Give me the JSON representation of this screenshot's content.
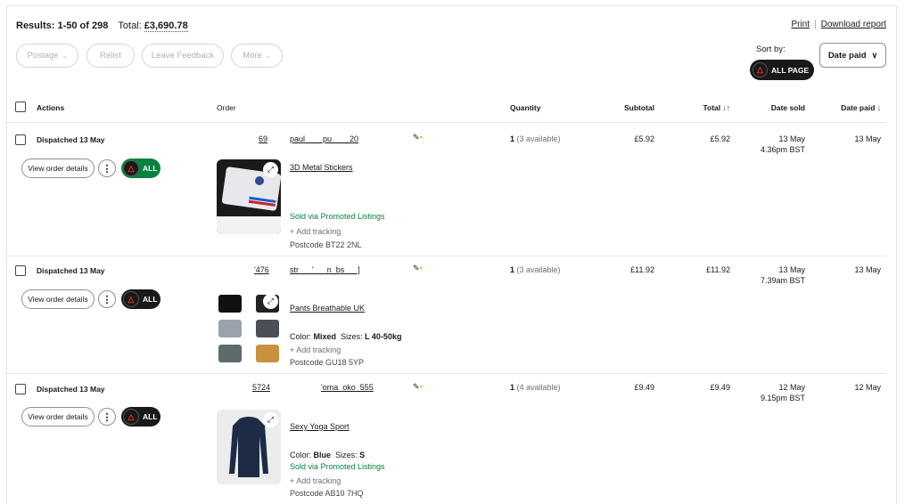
{
  "header": {
    "results": "Results: 1-50 of 298",
    "total_label": "Total:",
    "total_value": "£3,690.78",
    "print": "Print",
    "download": "Download report"
  },
  "filters": [
    "Postage",
    "Relist",
    "Leave Feedback",
    "More"
  ],
  "sort": {
    "label": "Sort by:",
    "all_page": "ALL PAGE",
    "selected": "Date paid"
  },
  "columns": {
    "actions": "Actions",
    "order": "Order",
    "quantity": "Quantity",
    "subtotal": "Subtotal",
    "total": "Total ↓↑",
    "date_sold": "Date sold",
    "date_paid": "Date paid ↓"
  },
  "rows": [
    {
      "status": "Dispatched 13 May",
      "view_btn": "View order details",
      "all_label": "ALL",
      "order_id": "69",
      "buyer": "paul        pu      _20",
      "item_title": "3D Metal Stickers",
      "variant_color_label": "",
      "variant_color": "",
      "variant_size_label": "",
      "variant_size": "",
      "promoted": "Sold via Promoted Listings",
      "tracking": "+ Add tracking",
      "postcode": "Postcode BT22 2NL",
      "qty": "1",
      "qty_avail": "(3 available)",
      "subtotal": "£5.92",
      "total": "£5.92",
      "date_sold": "13 May",
      "time_sold": "4.36pm BST",
      "date_paid": "13 May"
    },
    {
      "status": "Dispatched 13 May",
      "view_btn": "View order details",
      "all_label": "ALL",
      "order_id": "'476",
      "buyer": "str      '      n  bs      ]",
      "item_title": "Pants Breathable UK",
      "variant_color_label": "Color:",
      "variant_color": "Mixed",
      "variant_size_label": "Sizes:",
      "variant_size": "L 40-50kg",
      "promoted": "",
      "tracking": "+ Add tracking",
      "postcode": "Postcode GU18 5YP",
      "qty": "1",
      "qty_avail": "(3 available)",
      "subtotal": "£11.92",
      "total": "£11.92",
      "date_sold": "13 May",
      "time_sold": "7.39am BST",
      "date_paid": "13 May"
    },
    {
      "status": "Dispatched 13 May",
      "view_btn": "View order details",
      "all_label": "ALL",
      "order_id": "5724",
      "buyer": "'oma  oko_555",
      "item_title": "Sexy Yoga Sport",
      "variant_color_label": "Color:",
      "variant_color": "Blue",
      "variant_size_label": "Sizes:",
      "variant_size": "S",
      "promoted": "Sold via Promoted Listings",
      "tracking": "+ Add tracking",
      "postcode": "Postcode AB10 7HQ",
      "qty": "1",
      "qty_avail": "(4 available)",
      "subtotal": "£9.49",
      "total": "£9.49",
      "date_sold": "12 May",
      "time_sold": "9.15pm BST",
      "date_paid": "12 May"
    }
  ],
  "colors": {
    "all_btn_first": "#05823f",
    "all_btn_other": "#191919",
    "promoted_text": "#05823f"
  }
}
